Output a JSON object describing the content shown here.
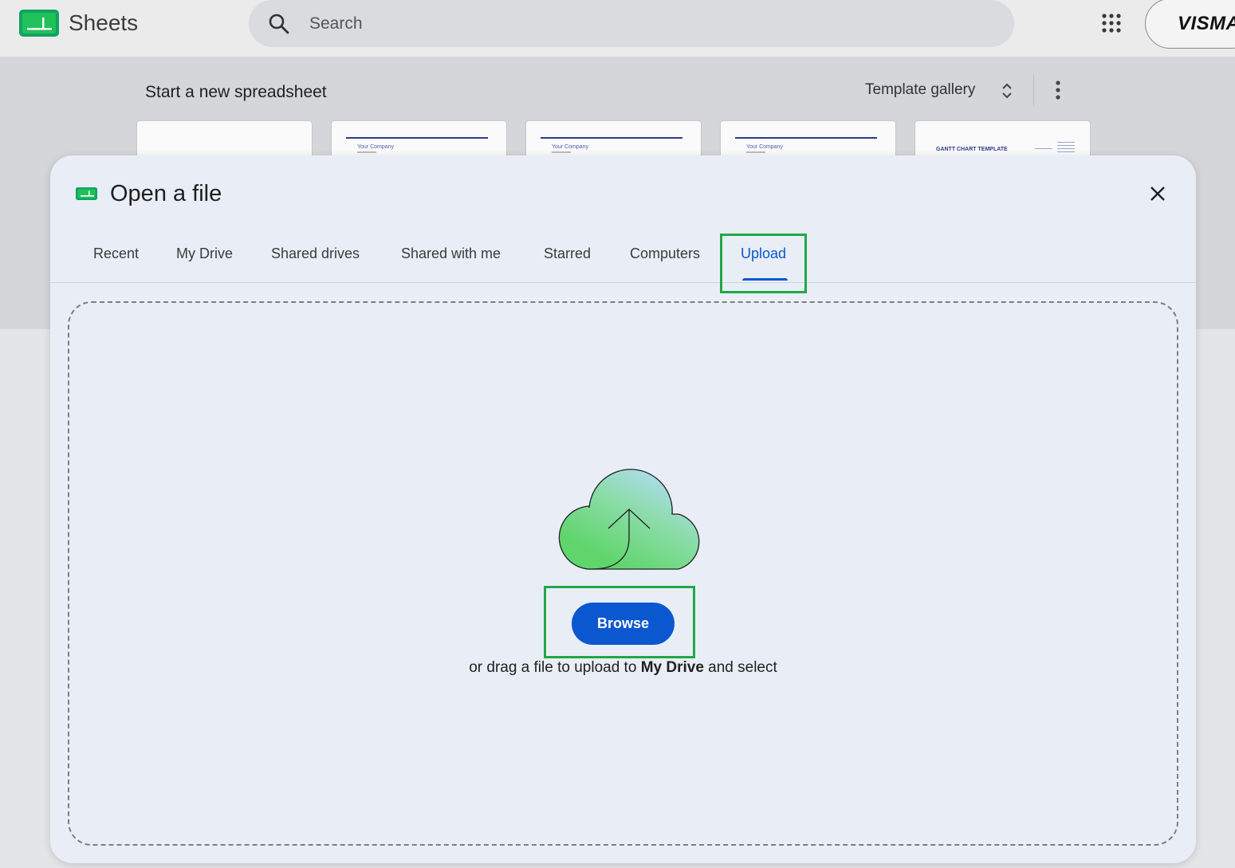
{
  "app": {
    "name": "Sheets"
  },
  "search": {
    "placeholder": "Search"
  },
  "account": {
    "logo_text": "VISMA"
  },
  "templates": {
    "title": "Start a new spreadsheet",
    "gallery_label": "Template gallery",
    "cards": [
      {
        "kind": "blank",
        "label": ""
      },
      {
        "kind": "invoice",
        "label": "Your Company"
      },
      {
        "kind": "invoice",
        "label": "Your Company"
      },
      {
        "kind": "invoice",
        "label": "Your Company"
      },
      {
        "kind": "gantt",
        "label": "GANTT CHART TEMPLATE"
      }
    ]
  },
  "dialog": {
    "title": "Open a file",
    "tabs": [
      {
        "label": "Recent",
        "active": false
      },
      {
        "label": "My Drive",
        "active": false
      },
      {
        "label": "Shared drives",
        "active": false
      },
      {
        "label": "Shared with me",
        "active": false
      },
      {
        "label": "Starred",
        "active": false
      },
      {
        "label": "Computers",
        "active": false
      },
      {
        "label": "Upload",
        "active": true
      }
    ],
    "upload": {
      "browse_label": "Browse",
      "drag_prefix": "or drag a file to upload to ",
      "drag_target": "My Drive",
      "drag_suffix": " and select"
    }
  },
  "colors": {
    "accent_blue": "#0b57d0",
    "highlight_green": "#22a746",
    "sheets_green": "#34a853",
    "dialog_bg": "#e9eef6"
  },
  "icons": {
    "app_logo": "sheets-logo-icon",
    "search": "search-icon",
    "apps": "apps-grid-icon",
    "gallery_toggle": "unfold-icon",
    "more": "more-vert-icon",
    "dialog": "sheets-icon",
    "close": "close-icon",
    "upload": "cloud-upload-icon"
  }
}
